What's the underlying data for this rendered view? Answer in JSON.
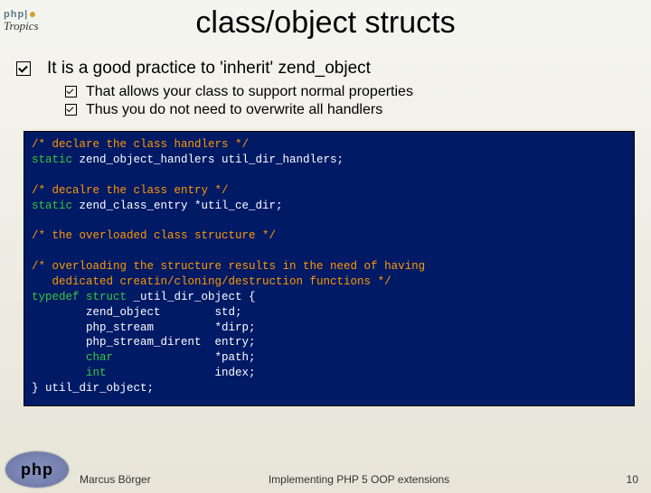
{
  "logo": {
    "php": "php",
    "tropics": "Tropics"
  },
  "title": "class/object structs",
  "main_bullet": "It is a good practice to 'inherit' zend_object",
  "sub_bullets": [
    "That allows your class to support normal properties",
    "Thus you do not need to overwrite all handlers"
  ],
  "code": {
    "c1": "/* declare the class handlers */",
    "l1a": "static ",
    "l1b": "zend_object_handlers util_dir_handlers;",
    "c2": "/* decalre the class entry */",
    "l2a": "static ",
    "l2b": "zend_class_entry *util_ce_dir;",
    "c3": "/* the overloaded class structure */",
    "c4a": "/* overloading the structure results in the need of having",
    "c4b": "   dedicated creatin/cloning/destruction functions */",
    "l3a": "typedef struct ",
    "l3b": "_util_dir_object {",
    "f1": "        zend_object        std;",
    "f2": "        php_stream         *dirp;",
    "f3": "        php_stream_dirent  entry;",
    "f4a": "        ",
    "f4k": "char",
    "f4b": "               *path;",
    "f5a": "        ",
    "f5k": "int",
    "f5b": "                index;",
    "l4": "} util_dir_object;"
  },
  "footer": {
    "author": "Marcus Börger",
    "title": "Implementing PHP 5 OOP extensions",
    "page": "10"
  },
  "php_logo_text": "php"
}
